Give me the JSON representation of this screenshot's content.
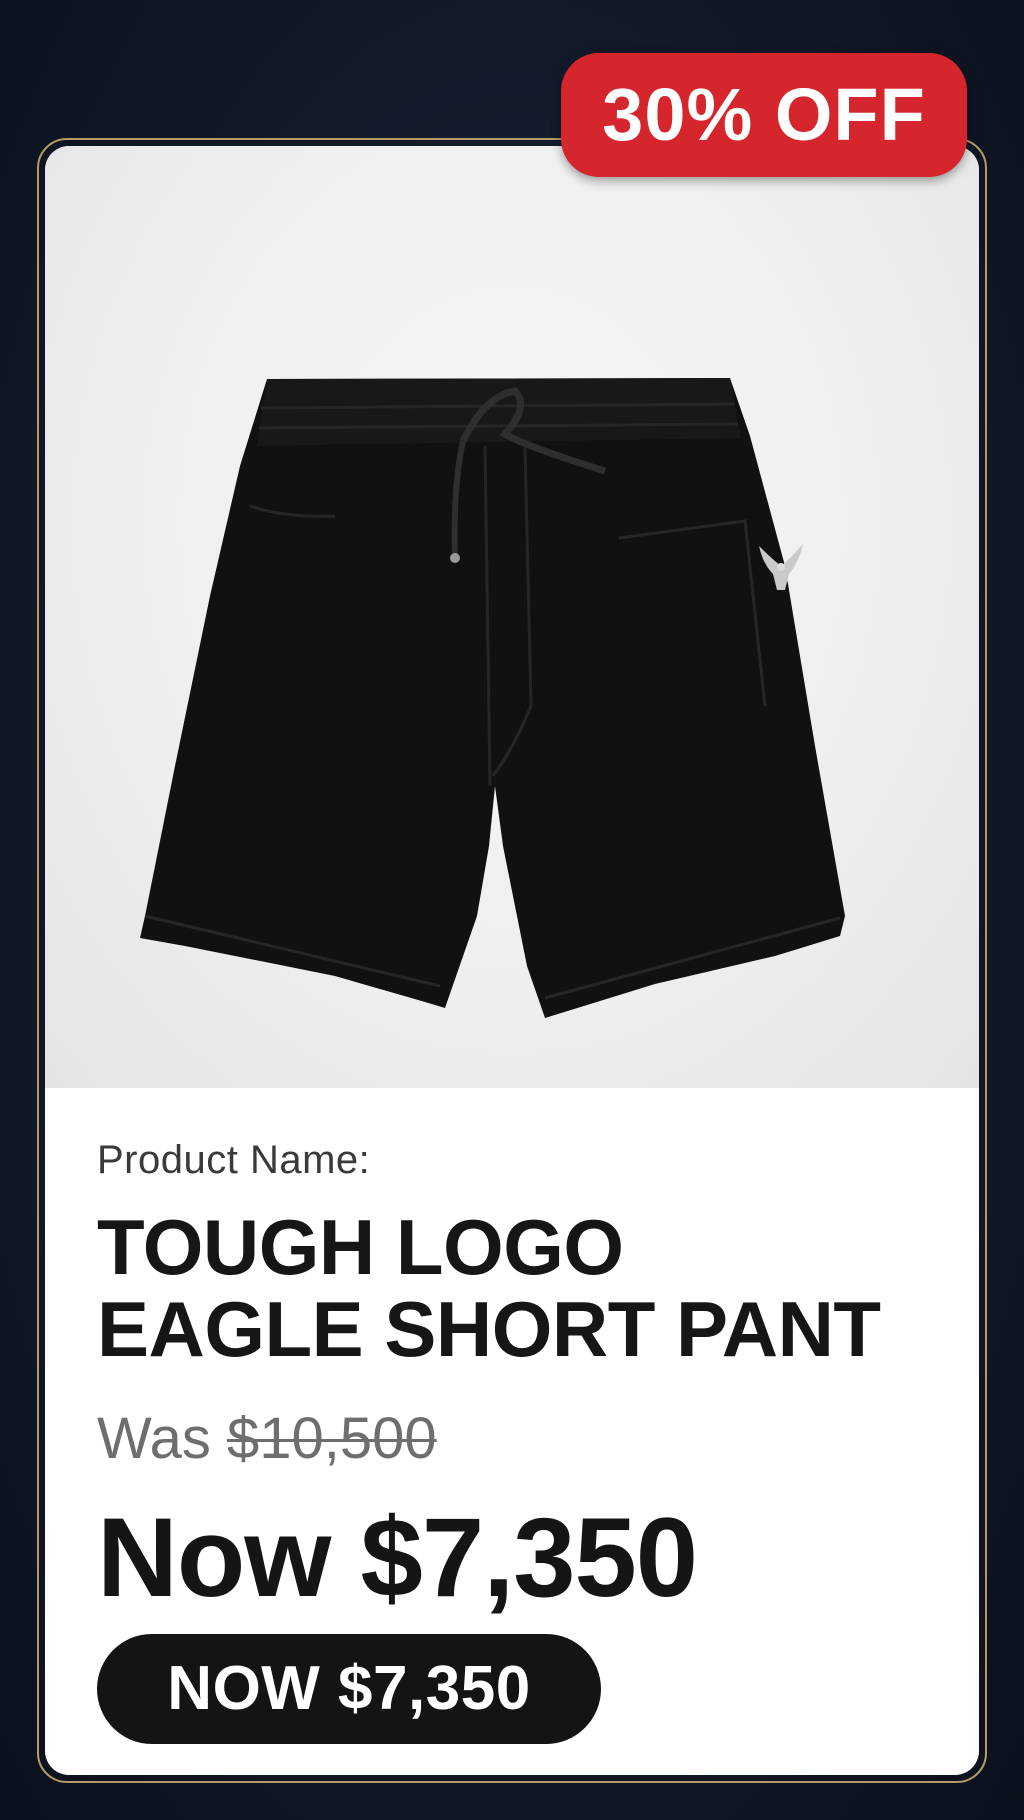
{
  "badge": {
    "label": "30% OFF",
    "color": "#d4262c"
  },
  "product": {
    "label": "Product Name:",
    "title_line1": "TOUGH LOGO",
    "title_line2": "EAGLE SHORT PANT",
    "image_icon": "shorts-image"
  },
  "pricing": {
    "was_prefix": "Was ",
    "was_price": "$10,500",
    "now_price": "Now $7,350"
  },
  "cta": {
    "label": "NOW $7,350"
  },
  "colors": {
    "accent": "#d4262c",
    "frame": "#b59a63",
    "background": "#121a2a"
  }
}
